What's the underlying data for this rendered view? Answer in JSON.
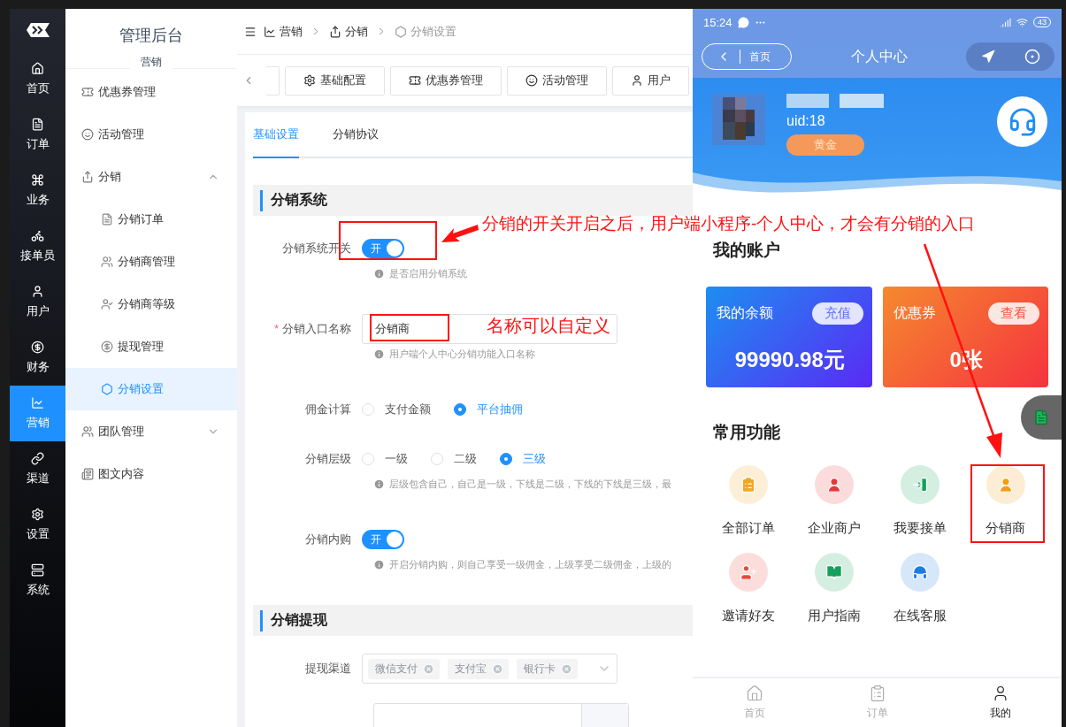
{
  "sidebar": {
    "items": [
      {
        "label": "首页",
        "selected": false
      },
      {
        "label": "订单",
        "selected": false
      },
      {
        "label": "业务",
        "selected": false
      },
      {
        "label": "接单员",
        "selected": false
      },
      {
        "label": "用户",
        "selected": false
      },
      {
        "label": "财务",
        "selected": false
      },
      {
        "label": "营销",
        "selected": true
      },
      {
        "label": "渠道",
        "selected": false
      },
      {
        "label": "设置",
        "selected": false
      },
      {
        "label": "系统",
        "selected": false
      }
    ]
  },
  "menu": {
    "title": "管理后台",
    "subtitle": "营销",
    "items": [
      {
        "label": "优惠券管理",
        "selected": false
      },
      {
        "label": "活动管理",
        "selected": false
      },
      {
        "label": "分销",
        "selected": false,
        "expanded": true,
        "children": [
          {
            "label": "分销订单",
            "selected": false
          },
          {
            "label": "分销商管理",
            "selected": false
          },
          {
            "label": "分销商等级",
            "selected": false
          },
          {
            "label": "提现管理",
            "selected": false
          },
          {
            "label": "分销设置",
            "selected": true
          }
        ]
      },
      {
        "label": "团队管理",
        "selected": false,
        "expanded": false
      },
      {
        "label": "图文内容",
        "selected": false
      }
    ]
  },
  "breadcrumb": [
    "营销",
    "分销",
    "分销设置"
  ],
  "quick_tags": [
    "基础配置",
    "优惠券管理",
    "活动管理",
    "用户"
  ],
  "tabs": [
    {
      "label": "基础设置",
      "selected": true
    },
    {
      "label": "分销协议",
      "selected": false
    }
  ],
  "sections": [
    {
      "title": "分销系统",
      "fields": [
        {
          "kind": "switch",
          "label": "分销系统开关",
          "on": true,
          "switch_text": "开",
          "hint": "是否启用分销系统"
        },
        {
          "kind": "input",
          "label": "分销入口名称",
          "required_mark": "*",
          "value": "分销商",
          "hint": "用户端个人中心分销功能入口名称"
        },
        {
          "kind": "radio",
          "label": "佣金计算",
          "options": [
            {
              "label": "支付金额",
              "selected": false
            },
            {
              "label": "平台抽佣",
              "selected": true
            }
          ]
        },
        {
          "kind": "radio",
          "label": "分销层级",
          "options": [
            {
              "label": "一级",
              "selected": false
            },
            {
              "label": "二级",
              "selected": false
            },
            {
              "label": "三级",
              "selected": true
            }
          ],
          "hint": "层级包含自己，自己是一级，下线是二级，下线的下线是三级，最"
        },
        {
          "kind": "switch",
          "label": "分销内购",
          "on": true,
          "switch_text": "开",
          "hint": "开启分销内购，则自己享受一级佣金，上级享受二级佣金，上级的"
        }
      ]
    },
    {
      "title": "分销提现",
      "fields": [
        {
          "kind": "tags",
          "label": "提现渠道",
          "tags": [
            "微信支付",
            "支付宝",
            "银行卡"
          ]
        },
        {
          "kind": "blank"
        }
      ]
    }
  ],
  "phone": {
    "status": {
      "time": "15:24",
      "battery": "43"
    },
    "nav": {
      "back_label": "首页",
      "title": "个人中心"
    },
    "profile": {
      "uid": "uid:18",
      "badge": "黄金"
    },
    "account": {
      "title": "我的账户",
      "cards": [
        {
          "kind": "balance",
          "label": "我的余额",
          "action": "充值",
          "value": "99990.98元"
        },
        {
          "kind": "coupon",
          "label": "优惠券",
          "action": "查看",
          "value": "0张"
        }
      ]
    },
    "functions": {
      "title": "常用功能",
      "items": [
        {
          "kind": "orders",
          "label": "全部订单",
          "color": "#f5a623"
        },
        {
          "kind": "merchant",
          "label": "企业商户",
          "color": "#e8383d"
        },
        {
          "kind": "accept",
          "label": "我要接单",
          "color": "#16a05d"
        },
        {
          "kind": "distributor",
          "label": "分销商",
          "color": "#f39c12"
        },
        {
          "kind": "invite",
          "label": "邀请好友",
          "color": "#e8483f"
        },
        {
          "kind": "guide",
          "label": "用户指南",
          "color": "#16a05d"
        },
        {
          "kind": "service",
          "label": "在线客服",
          "color": "#1e7be6"
        }
      ]
    },
    "tabbar": [
      {
        "label": "首页",
        "selected": false
      },
      {
        "label": "订单",
        "selected": false
      },
      {
        "label": "我的",
        "selected": true
      }
    ]
  },
  "annotations": [
    {
      "text": "分销的开关开启之后，用户端小程序-个人中心，才会有分销的入口"
    },
    {
      "text": "名称可以自定义"
    }
  ]
}
